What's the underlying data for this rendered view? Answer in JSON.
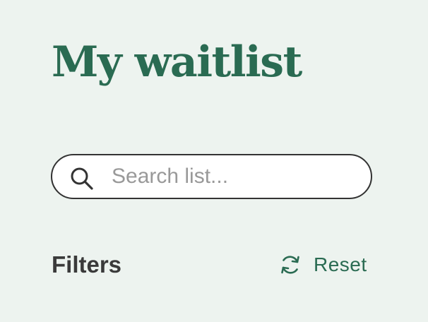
{
  "header": {
    "title": "My waitlist"
  },
  "search": {
    "placeholder": "Search list...",
    "value": "",
    "icon": "search-icon"
  },
  "filters": {
    "label": "Filters",
    "reset_label": "Reset",
    "reset_icon": "refresh-icon"
  },
  "colors": {
    "background": "#edf3ef",
    "accent": "#2a6b52",
    "text_dark": "#3a3a3a",
    "placeholder": "#999999"
  }
}
